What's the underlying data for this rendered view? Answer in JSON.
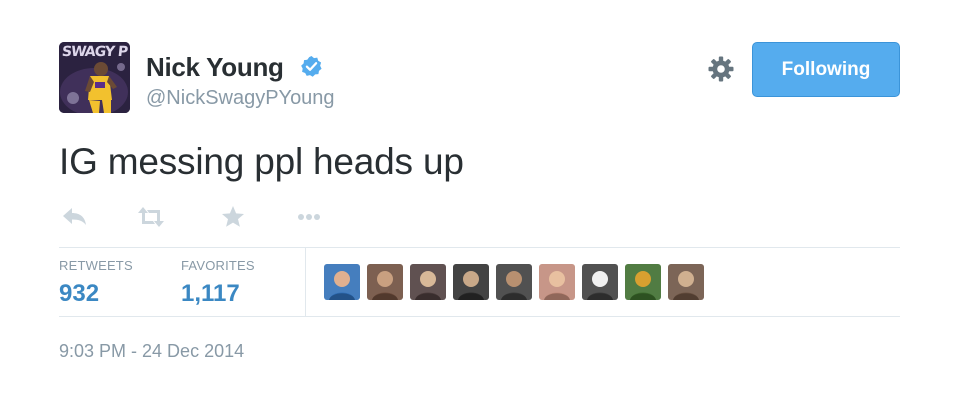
{
  "user": {
    "name": "Nick Young",
    "handle": "@NickSwagyPYoung",
    "verified": true,
    "avatar_text": "SWAGY P"
  },
  "follow_button": {
    "label": "Following",
    "color": "#55acee"
  },
  "tweet": {
    "text": "IG messing ppl heads up"
  },
  "actions": [
    "reply-icon",
    "retweet-icon",
    "favorite-icon",
    "more-icon"
  ],
  "stats": {
    "retweets_label": "RETWEETS",
    "retweets_count": "932",
    "favorites_label": "FAVORITES",
    "favorites_count": "1,117"
  },
  "favoriters": [
    {
      "colors": [
        "#2c6db5",
        "#e0b090"
      ]
    },
    {
      "colors": [
        "#6b4a3a",
        "#c9a080"
      ]
    },
    {
      "colors": [
        "#4a3a3a",
        "#d8b898"
      ]
    },
    {
      "colors": [
        "#2a2a2a",
        "#c8a888"
      ]
    },
    {
      "colors": [
        "#3a3a3a",
        "#b89070"
      ]
    },
    {
      "colors": [
        "#c08878",
        "#e8c0a0"
      ]
    },
    {
      "colors": [
        "#3a3a3a",
        "#f0f0f0"
      ]
    },
    {
      "colors": [
        "#3a6a2a",
        "#d8a030"
      ]
    },
    {
      "colors": [
        "#6a5040",
        "#d0b090"
      ]
    }
  ],
  "timestamp": "9:03 PM - 24 Dec 2014",
  "colors": {
    "link": "#3b88c3",
    "muted": "#8899a6",
    "text": "#292f33"
  }
}
